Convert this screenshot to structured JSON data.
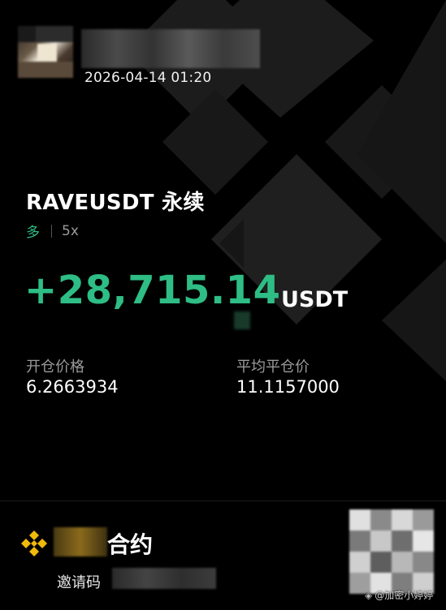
{
  "header": {
    "timestamp": "2026-04-14 01:20"
  },
  "position": {
    "symbol": "RAVEUSDT 永续",
    "side": "多",
    "leverage": "5x",
    "pnl": "+28,715.14",
    "pnl_currency": "USDT",
    "entry_price_label": "开仓价格",
    "entry_price": "6.2663934",
    "close_price_label": "平均平仓价",
    "close_price": "11.1157000"
  },
  "footer": {
    "brand_suffix": "合约",
    "invite_label": "邀请码",
    "watermark": "@加密小婷婷"
  },
  "colors": {
    "profit": "#2ebd85",
    "brand": "#f0b90b",
    "background": "#000000"
  }
}
